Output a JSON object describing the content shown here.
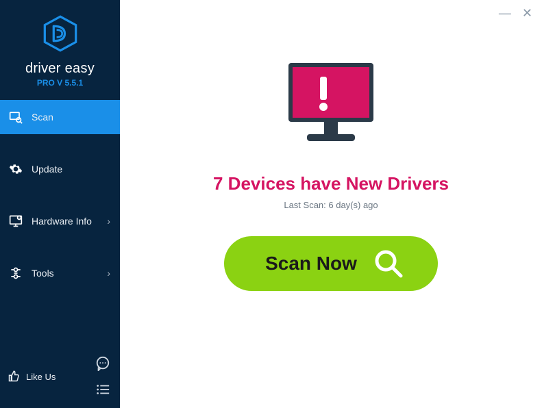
{
  "brand": {
    "name": "driver easy",
    "version_label": "PRO V 5.5.1"
  },
  "nav": {
    "scan": "Scan",
    "update": "Update",
    "hardware_info": "Hardware Info",
    "tools": "Tools"
  },
  "footer": {
    "like_us": "Like Us"
  },
  "main": {
    "headline": "7 Devices have New Drivers",
    "last_scan": "Last Scan: 6 day(s) ago",
    "scan_button": "Scan Now"
  },
  "colors": {
    "sidebar_bg": "#07243f",
    "accent": "#1a8fe8",
    "alert": "#d51462",
    "scan_green": "#8bd212"
  }
}
